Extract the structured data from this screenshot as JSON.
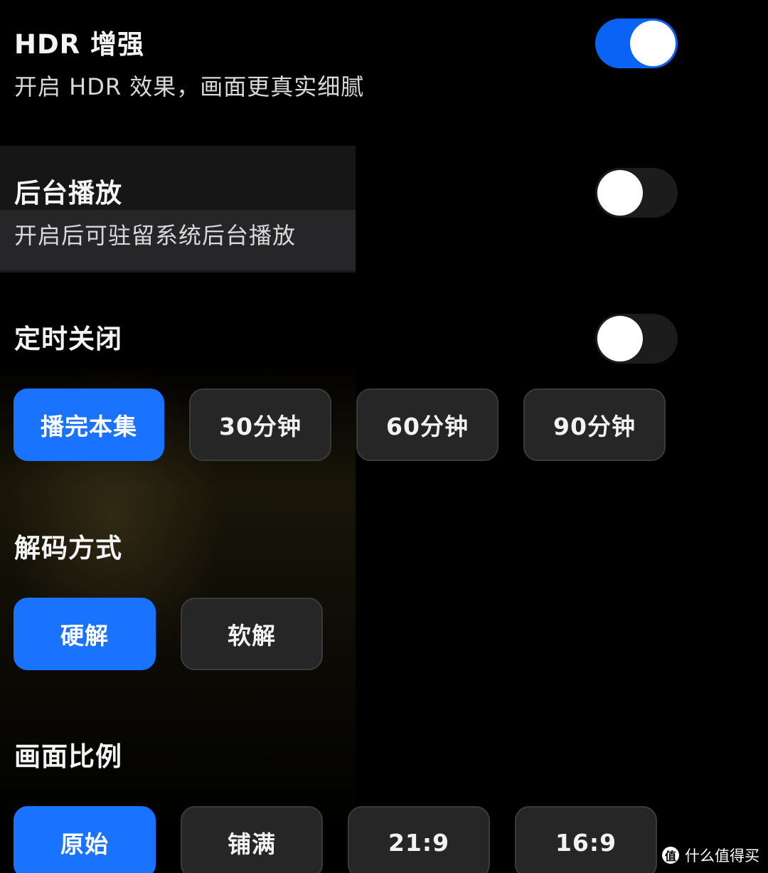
{
  "hdr": {
    "title": "HDR 增强",
    "description": "开启 HDR 效果，画面更真实细腻",
    "enabled": true
  },
  "background_play": {
    "title": "后台播放",
    "description": "开启后可驻留系统后台播放",
    "enabled": false
  },
  "sleep_timer": {
    "title": "定时关闭",
    "enabled": false,
    "options": [
      "播完本集",
      "30分钟",
      "60分钟",
      "90分钟"
    ],
    "selected": "播完本集"
  },
  "decoding": {
    "title": "解码方式",
    "options": [
      "硬解",
      "软解"
    ],
    "selected": "硬解"
  },
  "aspect_ratio": {
    "title": "画面比例",
    "options": [
      "原始",
      "铺满",
      "21:9",
      "16:9"
    ],
    "selected": "原始"
  },
  "watermark": {
    "icon_text": "值",
    "text": "什么值得买"
  },
  "colors": {
    "accent": "#1a73ff",
    "toggle_on": "#0a63f5",
    "button_bg": "#262626",
    "background": "#000000"
  }
}
